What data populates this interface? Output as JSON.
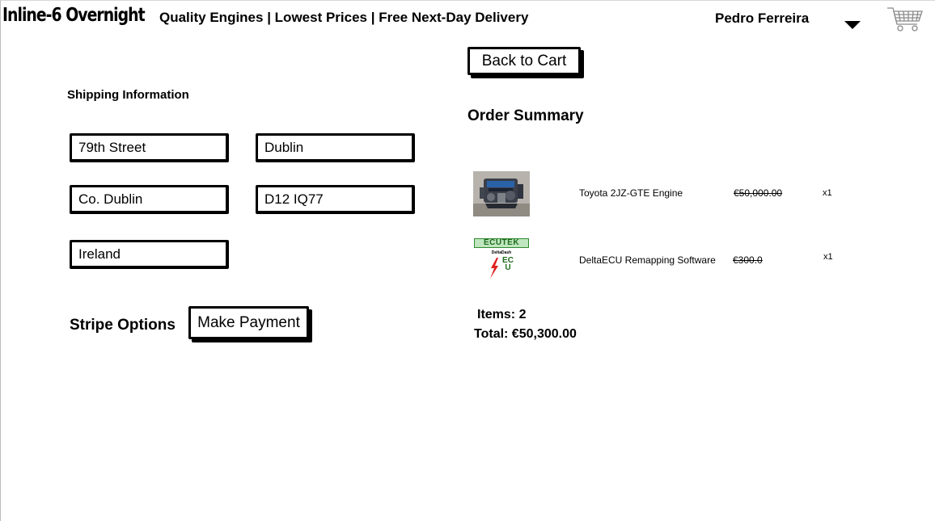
{
  "header": {
    "brand": "Inline-6 Overnight",
    "tagline": "Quality Engines | Lowest Prices | Free Next-Day Delivery",
    "user_name": "Pedro Ferreira",
    "user_menu_icon": "caret-down-icon",
    "cart_icon": "shopping-cart-icon"
  },
  "actions": {
    "back_to_cart": "Back to Cart",
    "make_payment": "Make Payment"
  },
  "shipping": {
    "title": "Shipping Information",
    "street": "79th Street",
    "city": "Dublin",
    "county": "Co. Dublin",
    "postcode": "D12 IQ77",
    "country": "Ireland"
  },
  "payment": {
    "title": "Stripe Options"
  },
  "order": {
    "title": "Order Summary",
    "items": [
      {
        "name": "Toyota 2JZ-GTE Engine",
        "price": "€50,000.00",
        "qty": "x1",
        "image": "engine-photo"
      },
      {
        "name": "DeltaECU Remapping Software",
        "price": "€300.0",
        "qty": "x1",
        "image": "ecutek-logo",
        "logo_text": "ECUTEK",
        "logo_sub": "DeltaDash",
        "logo_mark": "ECU"
      }
    ],
    "items_count": "Items: 2",
    "total": "Total: €50,300.00"
  }
}
